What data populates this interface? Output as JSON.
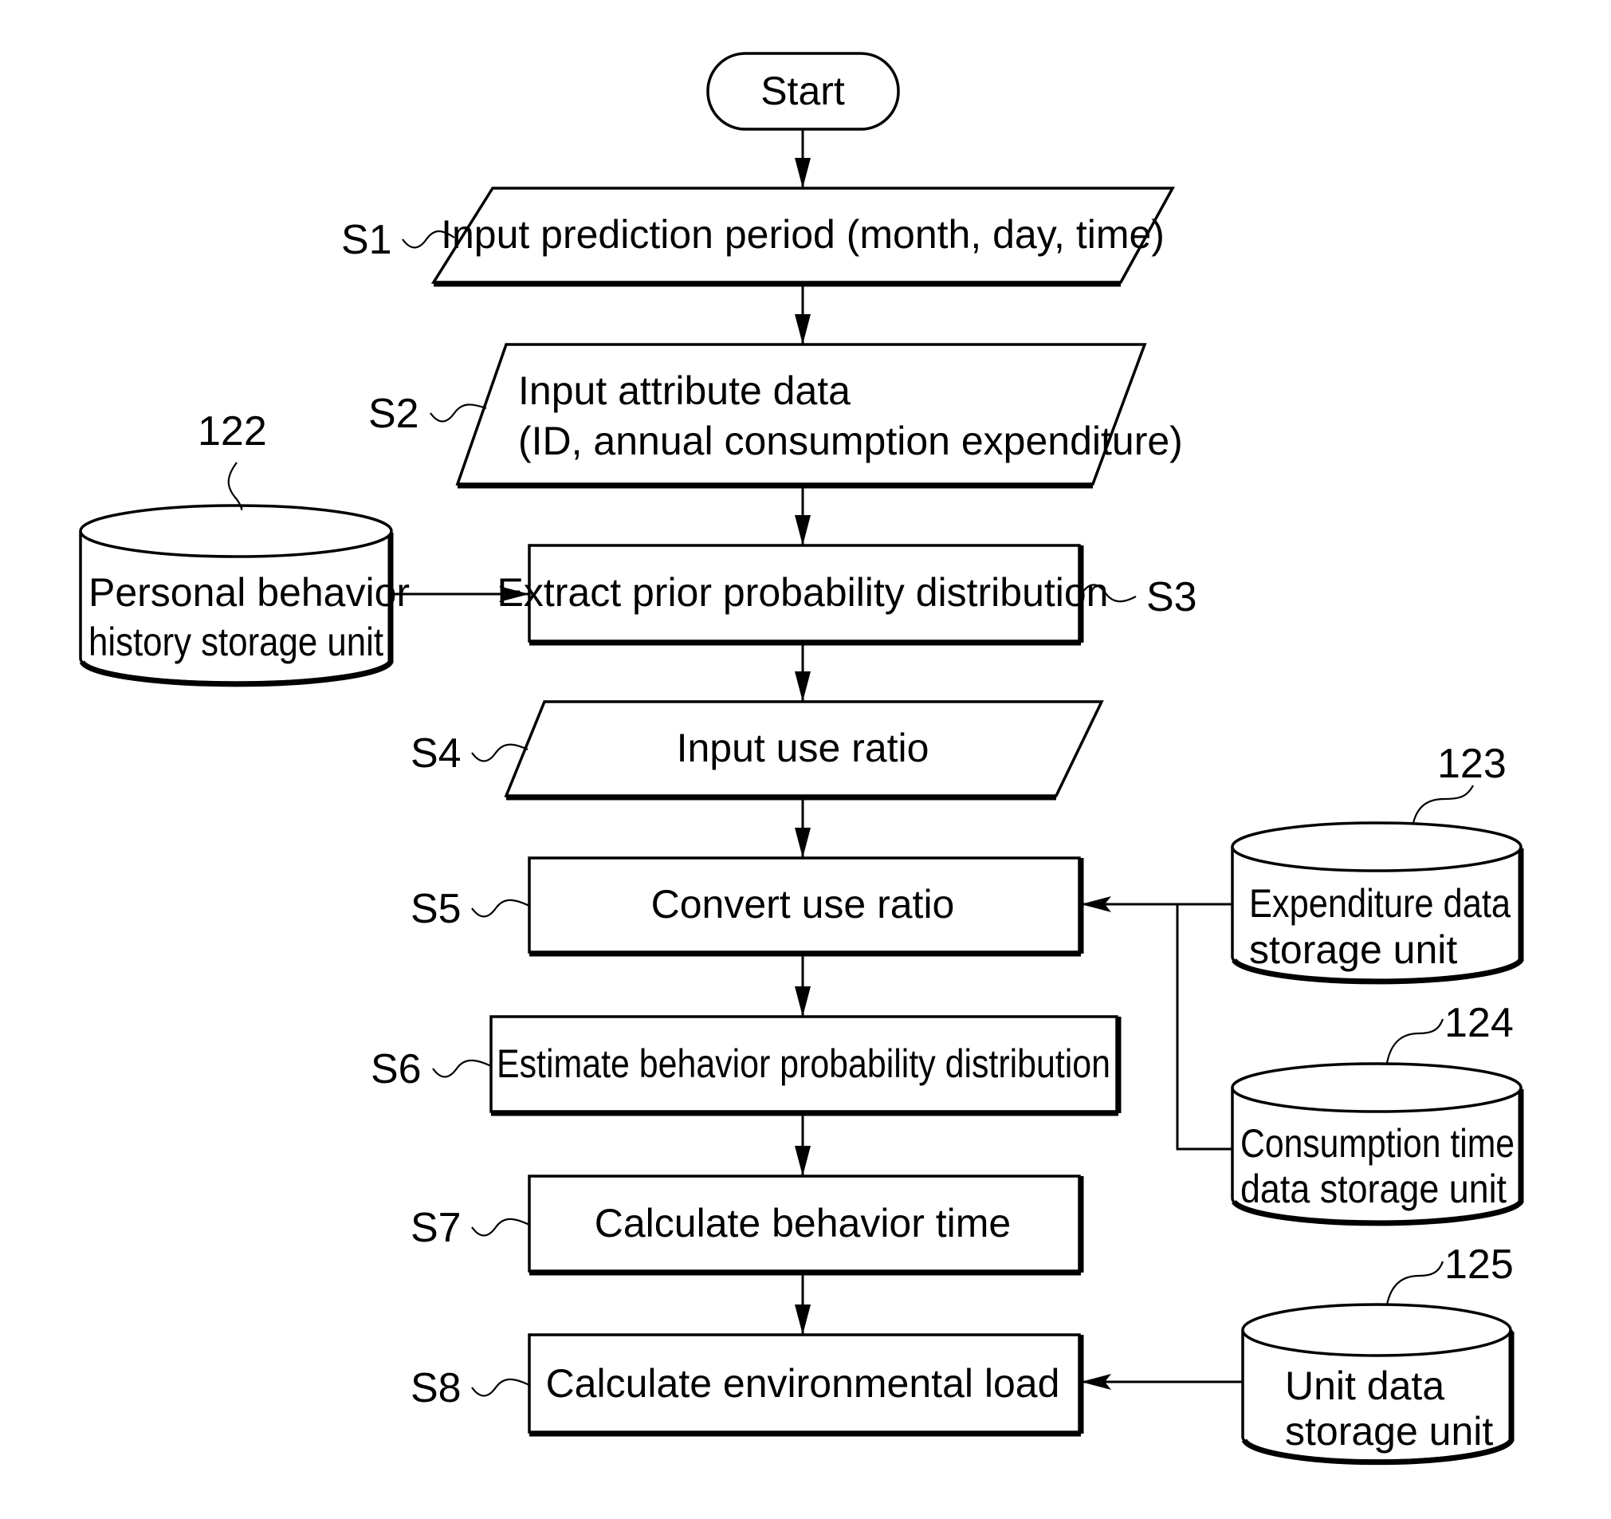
{
  "diagram": {
    "type": "flowchart",
    "terminal": {
      "label": "Start"
    },
    "steps": [
      {
        "id": "S1",
        "shape": "parallelogram",
        "lines": [
          "Input prediction period (month, day, time)"
        ]
      },
      {
        "id": "S2",
        "shape": "parallelogram",
        "lines": [
          "Input attribute data",
          "(ID, annual consumption expenditure)"
        ]
      },
      {
        "id": "S3",
        "shape": "process",
        "lines": [
          "Extract prior probability distribution"
        ]
      },
      {
        "id": "S4",
        "shape": "parallelogram",
        "lines": [
          "Input use ratio"
        ]
      },
      {
        "id": "S5",
        "shape": "process",
        "lines": [
          "Convert use ratio"
        ]
      },
      {
        "id": "S6",
        "shape": "process",
        "lines": [
          "Estimate behavior probability distribution"
        ]
      },
      {
        "id": "S7",
        "shape": "process",
        "lines": [
          "Calculate behavior time"
        ]
      },
      {
        "id": "S8",
        "shape": "process",
        "lines": [
          "Calculate environmental load"
        ]
      }
    ],
    "storages": [
      {
        "ref": "122",
        "lines": [
          "Personal behavior",
          "history storage unit"
        ],
        "feeds": "S3"
      },
      {
        "ref": "123",
        "lines": [
          "Expenditure data",
          "storage unit"
        ],
        "feeds": "S5"
      },
      {
        "ref": "124",
        "lines": [
          "Consumption time",
          "data storage unit"
        ],
        "feeds": "S5"
      },
      {
        "ref": "125",
        "lines": [
          "Unit data",
          "storage unit"
        ],
        "feeds": "S8"
      }
    ],
    "flow": [
      "Start",
      "S1",
      "S2",
      "S3",
      "S4",
      "S5",
      "S6",
      "S7",
      "S8"
    ]
  }
}
